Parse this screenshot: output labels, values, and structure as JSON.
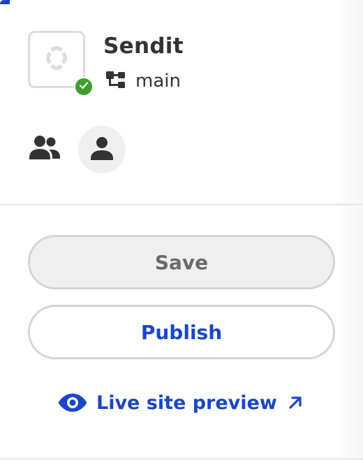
{
  "site": {
    "name": "Sendit",
    "branch": "main",
    "logo_icon": "site-logo-icon",
    "status_icon": "check-icon",
    "status_color": "#3aa02a"
  },
  "users": {
    "team_icon": "team-icon",
    "user_icon": "user-icon"
  },
  "actions": {
    "save_label": "Save",
    "publish_label": "Publish"
  },
  "preview": {
    "label": "Live site preview",
    "icon": "eye-icon",
    "external_icon": "external-link-icon"
  },
  "colors": {
    "accent": "#1a47c4",
    "text": "#333333",
    "muted": "#6a6a6a"
  }
}
